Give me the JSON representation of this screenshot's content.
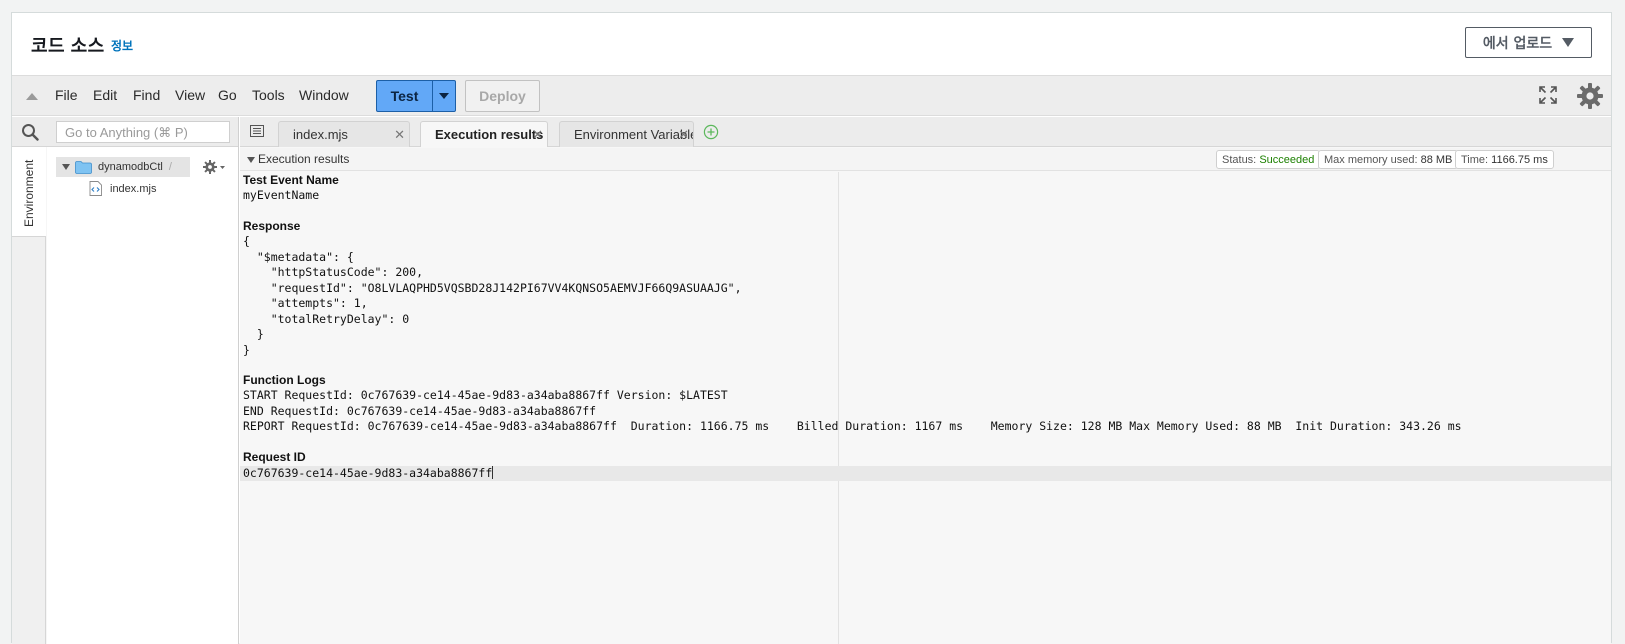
{
  "panel": {
    "title": "코드 소스",
    "info_link": "정보",
    "upload_button": "에서 업로드"
  },
  "menu": {
    "items": [
      "File",
      "Edit",
      "Find",
      "View",
      "Go",
      "Tools",
      "Window"
    ],
    "test_button": "Test",
    "deploy_button": "Deploy"
  },
  "sidebar": {
    "search_placeholder": "Go to Anything (⌘ P)",
    "env_tab": "Environment",
    "folder_name": "dynamodbCtl",
    "folder_suffix": "/",
    "file_name": "index.mjs"
  },
  "tabs": [
    {
      "label": "index.mjs",
      "active": false
    },
    {
      "label": "Execution results",
      "active": true
    },
    {
      "label": "Environment Variables",
      "active": false
    }
  ],
  "results": {
    "title": "Execution results",
    "status_label": "Status:",
    "status_value": "Succeeded",
    "memory_label": "Max memory used:",
    "memory_value": "88 MB",
    "time_label": "Time:",
    "time_value": "1166.75 ms",
    "test_event_label": "Test Event Name",
    "test_event_value": "myEventName",
    "response_label": "Response",
    "response_body": "{\n  \"$metadata\": {\n    \"httpStatusCode\": 200,\n    \"requestId\": \"O8LVLAQPHD5VQSBD28J142PI67VV4KQNSO5AEMVJF66Q9ASUAAJG\",\n    \"attempts\": 1,\n    \"totalRetryDelay\": 0\n  }\n}",
    "logs_label": "Function Logs",
    "logs_body": "START RequestId: 0c767639-ce14-45ae-9d83-a34aba8867ff Version: $LATEST\nEND RequestId: 0c767639-ce14-45ae-9d83-a34aba8867ff\nREPORT RequestId: 0c767639-ce14-45ae-9d83-a34aba8867ff  Duration: 1166.75 ms    Billed Duration: 1167 ms    Memory Size: 128 MB Max Memory Used: 88 MB  Init Duration: 343.26 ms",
    "request_id_label": "Request ID",
    "request_id_value": "0c767639-ce14-45ae-9d83-a34aba8867ff"
  },
  "colors": {
    "test_button": "#62a8f7",
    "status_ok": "#1d8102",
    "info_link": "#0073bb"
  }
}
